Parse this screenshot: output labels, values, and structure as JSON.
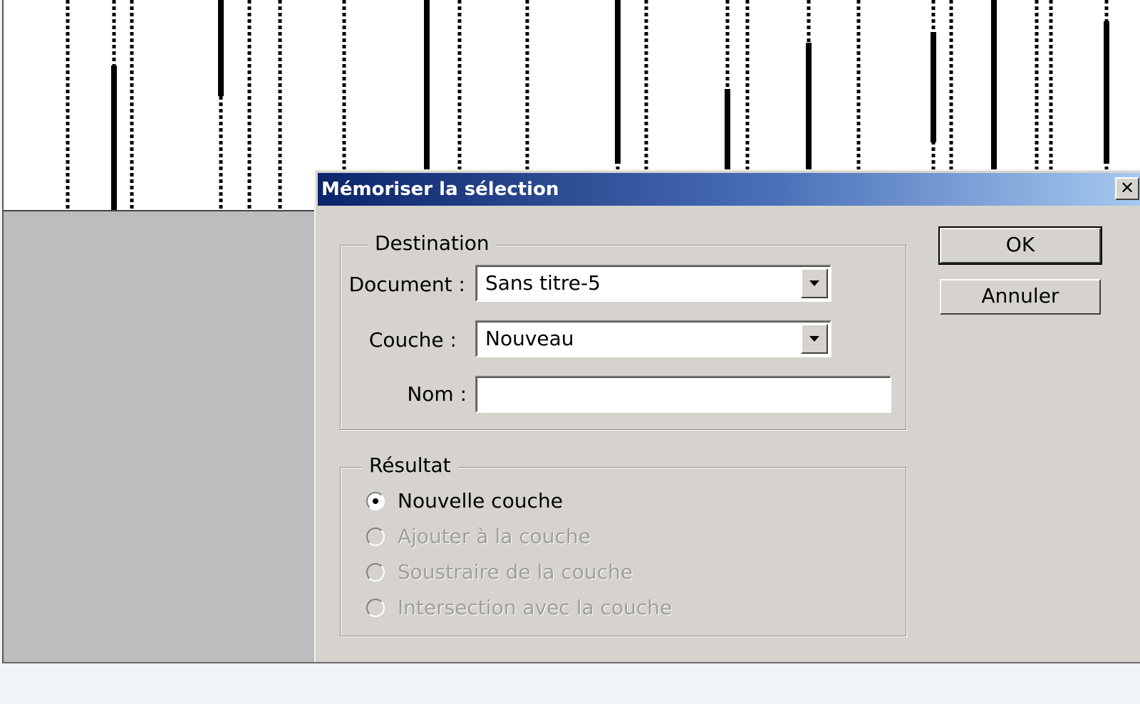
{
  "dialog": {
    "title": "Mémoriser la sélection",
    "close_symbol": "✕",
    "ok_label": "OK",
    "cancel_label": "Annuler",
    "destination": {
      "legend": "Destination",
      "document_label": "Document :",
      "document_value": "Sans titre-5",
      "layer_label": "Couche :",
      "layer_value": "Nouveau",
      "name_label": "Nom :",
      "name_value": ""
    },
    "result": {
      "legend": "Résultat",
      "options": [
        {
          "label": "Nouvelle couche",
          "selected": true,
          "enabled": true
        },
        {
          "label": "Ajouter à la couche",
          "selected": false,
          "enabled": false
        },
        {
          "label": "Soustraire de la couche",
          "selected": false,
          "enabled": false
        },
        {
          "label": "Intersection avec la couche",
          "selected": false,
          "enabled": false
        }
      ]
    }
  },
  "colors": {
    "dialog_bg": "#d6d3ce",
    "titlebar_start": "#0b246a",
    "titlebar_end": "#a6caf0",
    "workspace_bg": "#bdbdbd",
    "canvas_bg": "#ffffff",
    "page_bg": "#eef4f8"
  },
  "icons": {
    "close": "close-icon",
    "dropdown": "chevron-down-icon",
    "marching_ants": "selection-marquee"
  }
}
